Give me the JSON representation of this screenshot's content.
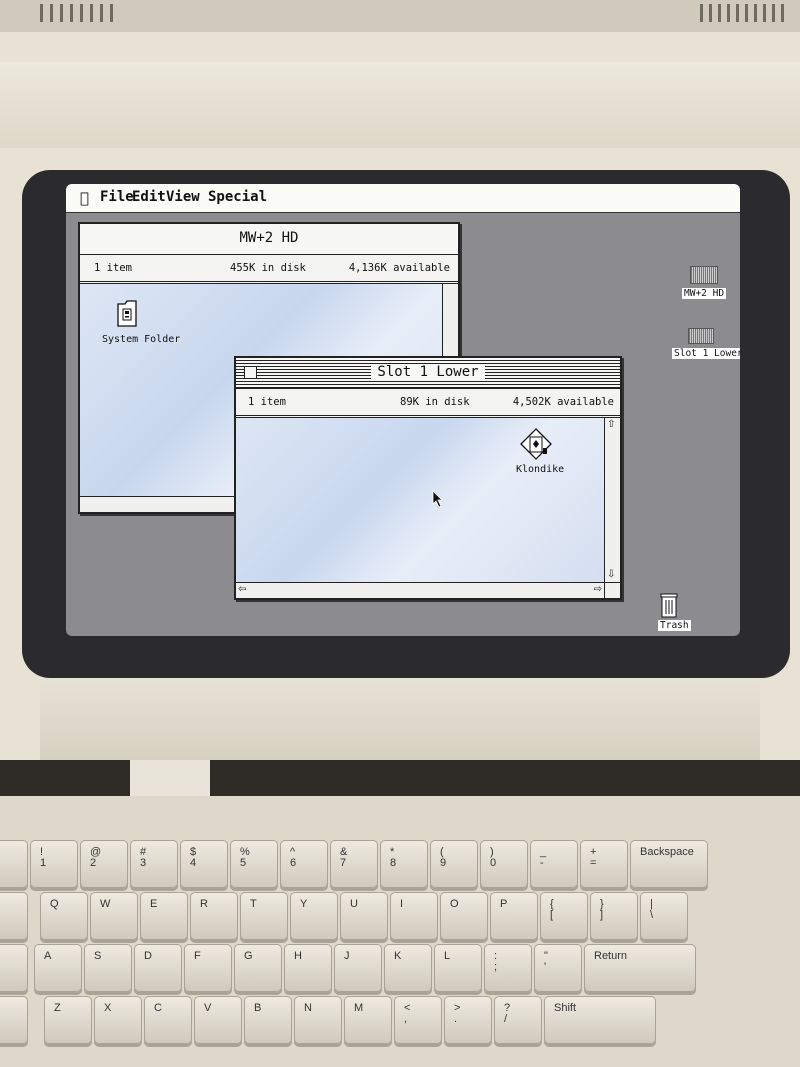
{
  "menubar": {
    "items": [
      "File",
      "Edit",
      "View",
      "Special"
    ]
  },
  "windows": {
    "hd": {
      "title": "MW+2 HD",
      "items_count": "1 item",
      "in_disk": "455K in disk",
      "available": "4,136K available",
      "icon_label": "System Folder"
    },
    "slot": {
      "title": "Slot 1 Lower",
      "items_count": "1 item",
      "in_disk": "89K in disk",
      "available": "4,502K available",
      "icon_label": "Klondike"
    }
  },
  "desktop": {
    "disk1_label": "MW+2 HD",
    "disk2_label": "Slot 1 Lower",
    "trash_label": "Trash"
  },
  "keyboard": {
    "row1": [
      {
        "top": "!",
        "bottom": "1"
      },
      {
        "top": "@",
        "bottom": "2"
      },
      {
        "top": "#",
        "bottom": "3"
      },
      {
        "top": "$",
        "bottom": "4"
      },
      {
        "top": "%",
        "bottom": "5"
      },
      {
        "top": "^",
        "bottom": "6"
      },
      {
        "top": "&",
        "bottom": "7"
      },
      {
        "top": "*",
        "bottom": "8"
      },
      {
        "top": "(",
        "bottom": "9"
      },
      {
        "top": ")",
        "bottom": "0"
      },
      {
        "top": "_",
        "bottom": "-"
      },
      {
        "top": "+",
        "bottom": "="
      }
    ],
    "backspace": "Backspace",
    "row2": [
      {
        "top": "Q"
      },
      {
        "top": "W"
      },
      {
        "top": "E"
      },
      {
        "top": "R"
      },
      {
        "top": "T"
      },
      {
        "top": "Y"
      },
      {
        "top": "U"
      },
      {
        "top": "I"
      },
      {
        "top": "O"
      },
      {
        "top": "P"
      },
      {
        "top": "{",
        "bottom": "["
      },
      {
        "top": "}",
        "bottom": "]"
      },
      {
        "top": "|",
        "bottom": "\\"
      }
    ],
    "row3": [
      {
        "top": "A"
      },
      {
        "top": "S"
      },
      {
        "top": "D"
      },
      {
        "top": "F"
      },
      {
        "top": "G"
      },
      {
        "top": "H"
      },
      {
        "top": "J"
      },
      {
        "top": "K"
      },
      {
        "top": "L"
      },
      {
        "top": ":",
        "bottom": ";"
      },
      {
        "top": "\"",
        "bottom": "'"
      }
    ],
    "return": "Return",
    "row4": [
      {
        "top": "Z"
      },
      {
        "top": "X"
      },
      {
        "top": "C"
      },
      {
        "top": "V"
      },
      {
        "top": "B"
      },
      {
        "top": "N"
      },
      {
        "top": "M"
      },
      {
        "top": "<",
        "bottom": ","
      },
      {
        "top": ">",
        "bottom": "."
      },
      {
        "top": "?",
        "bottom": "/"
      }
    ],
    "shift": "Shift"
  }
}
